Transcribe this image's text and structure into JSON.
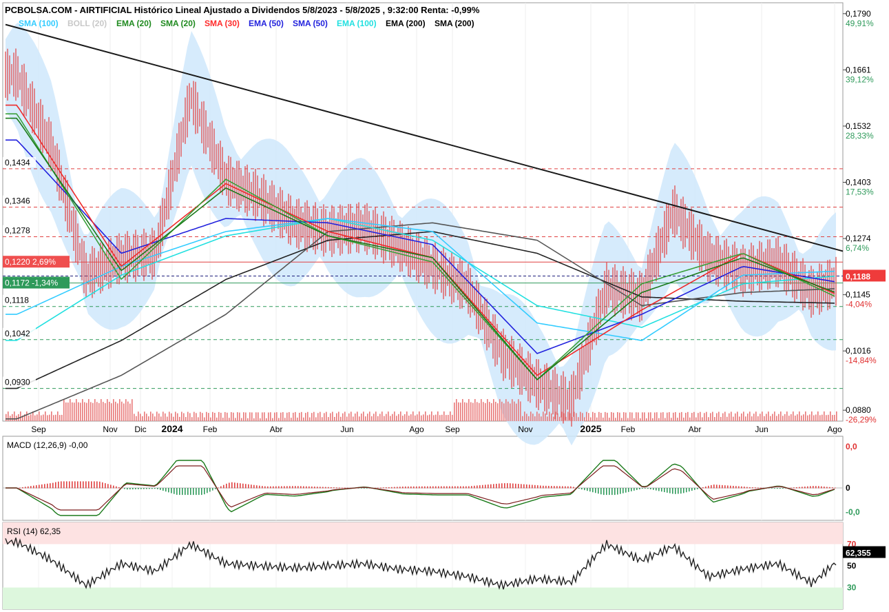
{
  "title": "PCBOLSA.COM - AIRTIFICIAL Histórico Lineal Ajustado a Dividendos 5/8/2023 - 5/8/2025 , 9:32:00 Renta: -0,99%",
  "legend": [
    {
      "label": "SMA (100)",
      "color": "#33ccff"
    },
    {
      "label": "BOLL (20)",
      "color": "#c8c8c8"
    },
    {
      "label": "EMA (20)",
      "color": "#1f8a1f"
    },
    {
      "label": "SMA (20)",
      "color": "#1f8a1f"
    },
    {
      "label": "SMA (30)",
      "color": "#ff2a2a"
    },
    {
      "label": "EMA (50)",
      "color": "#2222dd"
    },
    {
      "label": "SMA (50)",
      "color": "#2222dd"
    },
    {
      "label": "EMA (100)",
      "color": "#22e0e0"
    },
    {
      "label": "EMA (200)",
      "color": "#000000"
    },
    {
      "label": "SMA (200)",
      "color": "#000000"
    }
  ],
  "colors": {
    "price_bar": "#e24b4b",
    "volume": "#e87878",
    "band_fill": "#cfe8fb",
    "last_price_box": "#ef3b3b",
    "level_above_box": "#ef4f4f",
    "level_below_box": "#2e9a5a",
    "rsi_overbought_zone": "#fde2e2",
    "rsi_oversold_zone": "#ddf7dd"
  },
  "chart_data": {
    "type": "line",
    "y_scale": "price",
    "ylim": [
      0.0855,
      0.1815
    ],
    "x_ticks": [
      "Sep",
      "Nov",
      "Dic",
      "2024",
      "Feb",
      "Abr",
      "Jun",
      "Ago",
      "Sep",
      "Nov",
      "2025",
      "Feb",
      "Abr",
      "Jun",
      "Ago"
    ],
    "y_ticks_right": [
      {
        "value": "0,1790",
        "pct": "49,91%"
      },
      {
        "value": "0,1661",
        "pct": "39,12%"
      },
      {
        "value": "0,1532",
        "pct": "28,33%"
      },
      {
        "value": "0,1403",
        "pct": "17,53%"
      },
      {
        "value": "0,1274",
        "pct": "6,74%"
      },
      {
        "value": "0,1145",
        "pct": "-4,04%"
      },
      {
        "value": "0,1016",
        "pct": "-14,84%"
      },
      {
        "value": "0,0880",
        "pct": "-26,29%"
      }
    ],
    "levels_left": [
      {
        "label": "0,1434",
        "value": 0.1434,
        "style": "red-dashed"
      },
      {
        "label": "0,1346",
        "value": 0.1346,
        "style": "red-dashed"
      },
      {
        "label": "0,1278",
        "value": 0.1278,
        "style": "red-dashed"
      },
      {
        "label": "0,1220  2,69%",
        "value": 0.122,
        "style": "red-solid"
      },
      {
        "label": "0,1172  -1,34%",
        "value": 0.1172,
        "style": "green-solid"
      },
      {
        "label": "0,1118",
        "value": 0.1118,
        "style": "green-dashed"
      },
      {
        "label": "0,1042",
        "value": 0.1042,
        "style": "green-dashed"
      },
      {
        "label": "0,0930",
        "value": 0.093,
        "style": "green-dashed"
      }
    ],
    "last_price": {
      "label": "0,1188",
      "value": 0.1188
    },
    "trendline": {
      "from": {
        "x": "2023-08-05",
        "y": 0.1765
      },
      "to": {
        "x": "2025-08-05",
        "y": 0.1245
      }
    },
    "close_series": {
      "x": [
        "2023-08",
        "2023-09",
        "2023-10",
        "2023-11",
        "2023-12",
        "2024-01",
        "2024-02",
        "2024-03",
        "2024-04",
        "2024-05",
        "2024-06",
        "2024-07",
        "2024-08",
        "2024-09",
        "2024-10",
        "2024-11",
        "2024-12",
        "2025-01",
        "2025-02",
        "2025-03",
        "2025-04",
        "2025-05",
        "2025-06",
        "2025-07",
        "2025-08"
      ],
      "y": [
        0.165,
        0.148,
        0.119,
        0.123,
        0.124,
        0.16,
        0.141,
        0.137,
        0.131,
        0.129,
        0.13,
        0.126,
        0.121,
        0.116,
        0.101,
        0.094,
        0.09,
        0.116,
        0.114,
        0.134,
        0.123,
        0.12,
        0.122,
        0.115,
        0.1188
      ]
    },
    "moving_averages": [
      {
        "name": "EMA (200)",
        "x": [
          "2023-08",
          "2023-11",
          "2024-02",
          "2024-05",
          "2024-08",
          "2024-11",
          "2025-02",
          "2025-05",
          "2025-08"
        ],
        "y": [
          0.093,
          0.104,
          0.118,
          0.127,
          0.129,
          0.124,
          0.114,
          0.113,
          0.1125
        ]
      },
      {
        "name": "SMA (200)",
        "x": [
          "2023-08",
          "2023-11",
          "2024-02",
          "2024-05",
          "2024-08",
          "2024-11",
          "2025-02",
          "2025-05",
          "2025-08"
        ],
        "y": [
          0.086,
          0.096,
          0.11,
          0.129,
          0.131,
          0.127,
          0.112,
          0.115,
          0.116
        ]
      },
      {
        "name": "EMA (100)",
        "x": [
          "2023-08",
          "2023-11",
          "2024-02",
          "2024-05",
          "2024-08",
          "2024-11",
          "2025-02",
          "2025-05",
          "2025-08"
        ],
        "y": [
          0.104,
          0.119,
          0.128,
          0.132,
          0.127,
          0.112,
          0.107,
          0.117,
          0.119
        ]
      },
      {
        "name": "SMA (100)",
        "x": [
          "2023-08",
          "2023-11",
          "2024-02",
          "2024-05",
          "2024-08",
          "2024-11",
          "2025-02",
          "2025-05",
          "2025-08"
        ],
        "y": [
          0.11,
          0.121,
          0.129,
          0.132,
          0.129,
          0.108,
          0.104,
          0.119,
          0.12
        ]
      },
      {
        "name": "EMA (50)",
        "x": [
          "2023-08",
          "2023-11",
          "2024-02",
          "2024-05",
          "2024-08",
          "2024-11",
          "2025-02",
          "2025-05",
          "2025-08"
        ],
        "y": [
          0.15,
          0.124,
          0.132,
          0.131,
          0.126,
          0.101,
          0.11,
          0.121,
          0.117
        ]
      },
      {
        "name": "SMA (30)",
        "x": [
          "2023-08",
          "2023-11",
          "2024-02",
          "2024-05",
          "2024-08",
          "2024-11",
          "2025-02",
          "2025-05",
          "2025-08"
        ],
        "y": [
          0.158,
          0.121,
          0.14,
          0.129,
          0.123,
          0.096,
          0.111,
          0.124,
          0.1135
        ]
      },
      {
        "name": "SMA (20)",
        "x": [
          "2023-08",
          "2023-11",
          "2024-02",
          "2024-05",
          "2024-08",
          "2024-11",
          "2025-02",
          "2025-05",
          "2025-08"
        ],
        "y": [
          0.156,
          0.118,
          0.141,
          0.128,
          0.122,
          0.095,
          0.117,
          0.124,
          0.1128
        ]
      },
      {
        "name": "EMA (20)",
        "x": [
          "2023-08",
          "2023-11",
          "2024-02",
          "2024-05",
          "2024-08",
          "2024-11",
          "2025-02",
          "2025-05",
          "2025-08"
        ],
        "y": [
          0.155,
          0.12,
          0.139,
          0.128,
          0.123,
          0.095,
          0.115,
          0.123,
          0.114
        ]
      }
    ]
  },
  "macd": {
    "label": "MACD (12,26,9)   -0,00",
    "ticks": [
      "0,0",
      "0",
      "-0,0"
    ]
  },
  "rsi": {
    "label": "RSI (14)   62,35",
    "value_box": "62,355",
    "ticks": [
      "70",
      "50",
      "30"
    ],
    "x": [
      "2023-08",
      "2023-09",
      "2023-10",
      "2023-11",
      "2023-12",
      "2024-01",
      "2024-02",
      "2024-03",
      "2024-04",
      "2024-05",
      "2024-06",
      "2024-07",
      "2024-08",
      "2024-09",
      "2024-10",
      "2024-11",
      "2024-12",
      "2025-01",
      "2025-02",
      "2025-03",
      "2025-04",
      "2025-05",
      "2025-06",
      "2025-07",
      "2025-08"
    ],
    "y": [
      72,
      55,
      32,
      52,
      45,
      70,
      52,
      50,
      48,
      50,
      52,
      47,
      45,
      40,
      32,
      38,
      35,
      70,
      55,
      68,
      40,
      47,
      52,
      34,
      62.35
    ]
  }
}
